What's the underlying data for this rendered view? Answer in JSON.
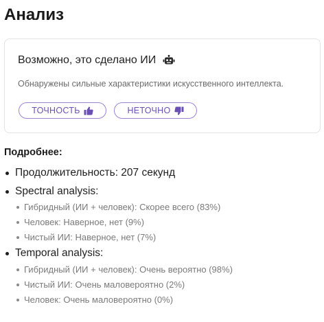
{
  "header": {
    "title": "Анализ"
  },
  "verdict_card": {
    "headline": "Возможно, это сделано ИИ",
    "icon": "robot-icon",
    "description": "Обнаружены сильные характеристики искусственного интеллекта.",
    "accuracy_button": {
      "label": "ТОЧНОСТЬ",
      "icon": "thumbs-up-icon"
    },
    "inaccurate_button": {
      "label": "НЕТОЧНО",
      "icon": "thumbs-down-icon"
    },
    "accent_color": "#6a4fb4",
    "border_color": "#9b82d3"
  },
  "details": {
    "title": "Подробнее:",
    "duration": "Продолжительность: 207 секунд",
    "sections": [
      {
        "label": "Spectral analysis:",
        "items": [
          "Гибридный (ИИ + человек): Скорее всего (83%)",
          "Человек: Наверное, нет (9%)",
          "Чистый ИИ: Наверное, нет (7%)"
        ]
      },
      {
        "label": "Temporal analysis:",
        "items": [
          "Гибридный (ИИ + человек): Очень вероятно (98%)",
          "Чистый ИИ: Очень маловероятно (2%)",
          "Человек: Очень маловероятно (0%)"
        ]
      }
    ]
  }
}
